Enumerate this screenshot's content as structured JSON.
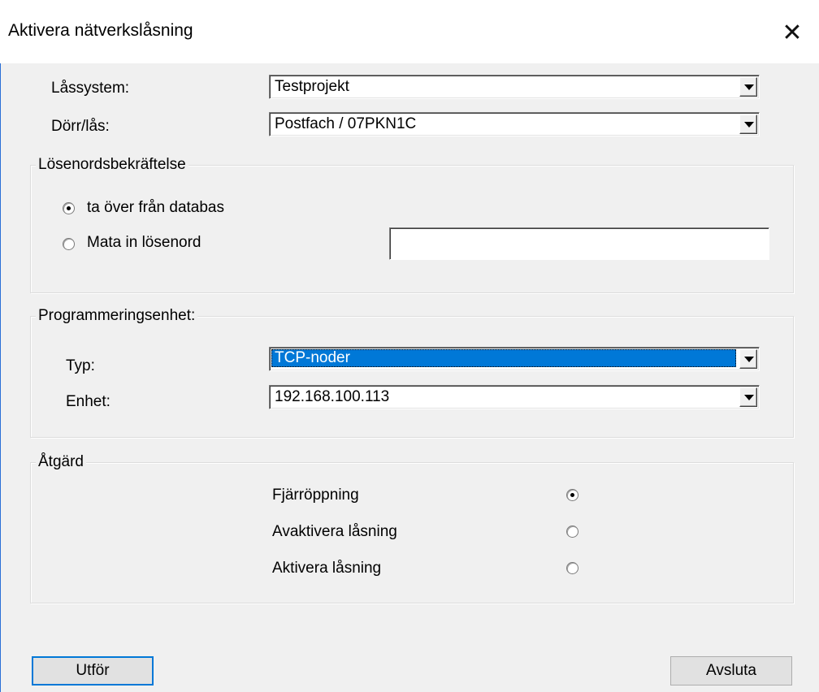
{
  "window": {
    "title": "Aktivera nätverkslåsning",
    "close_glyph": "✕"
  },
  "top_fields": {
    "lock_system_label": "Låssystem:",
    "lock_system_value": "Testprojekt",
    "door_label": "Dörr/lås:",
    "door_value": "Postfach / 07PKN1C"
  },
  "password_group": {
    "legend": "Lösenordsbekräftelse",
    "option_database": "ta över från databas",
    "option_manual": "Mata in lösenord",
    "password_value": "",
    "selected": "database"
  },
  "programming_group": {
    "legend": "Programmeringsenhet:",
    "type_label": "Typ:",
    "type_value": "TCP-noder",
    "unit_label": "Enhet:",
    "unit_value": "192.168.100.113"
  },
  "action_group": {
    "legend": "Åtgärd",
    "options": [
      {
        "label": "Fjärröppning",
        "selected": true
      },
      {
        "label": "Avaktivera låsning",
        "selected": false
      },
      {
        "label": "Aktivera låsning",
        "selected": false
      }
    ]
  },
  "buttons": {
    "execute": "Utför",
    "close": "Avsluta"
  },
  "icons": {
    "dropdown": "chevron-down-icon",
    "close": "close-icon"
  },
  "colors": {
    "selection": "#0078d7",
    "window_border": "#2a6fd6",
    "dialog_bg": "#f0f0f0"
  }
}
